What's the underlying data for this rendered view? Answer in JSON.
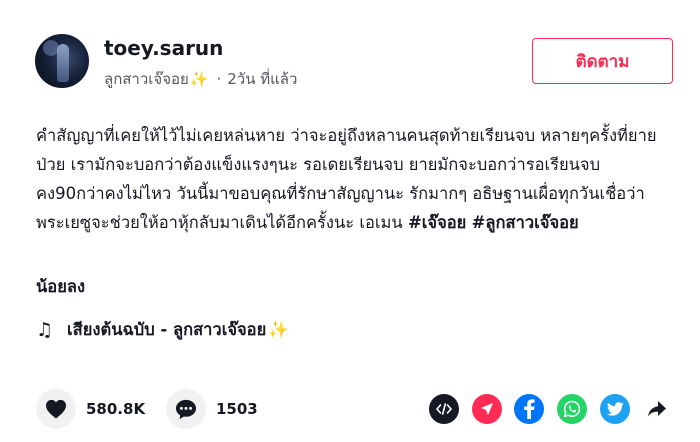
{
  "author": {
    "username": "toey.sarun",
    "display_name": "ลูกสาวเจ๊จอย",
    "spark": "✨",
    "separator": "·",
    "posted_ago": "2วัน ที่แล้ว"
  },
  "follow_label": "ติดตาม",
  "caption": {
    "text": "คำสัญญาที่เคยให้ไว้ไม่เคยหล่นหาย ว่าจะอยู่ถึงหลานคนสุดท้ายเรียนจบ หลายๆครั้งที่ยายป่วย เรามักจะบอกว่าต้องแข็งแรงๆนะ รอเดยเรียนจบ ยายมักจะบอกว่ารอเรียนจบคง90กว่าคงไม่ไหว วันนี้มาขอบคุณที่รักษาสัญญานะ รักมากๆ อธิษฐานเผื่อทุกวันเชื่อว่าพระเยซูจะช่วยให้อาหุ้กลับมาเดินได้อีกครั้งนะ เอเมน",
    "hashtags": [
      "#เจ๊จอย",
      "#ลูกสาวเจ๊จอย"
    ],
    "less_label": "น้อยลง"
  },
  "music": {
    "note_glyph": "♫",
    "title": "เสียงต้นฉบับ - ลูกสาวเจ๊จอย",
    "spark": "✨"
  },
  "stats": {
    "likes": "580.8K",
    "comments": "1503"
  },
  "share_icons": [
    {
      "name": "embed-icon",
      "color": "#161823"
    },
    {
      "name": "send-to-friends-icon",
      "color": "#fe2c55"
    },
    {
      "name": "facebook-icon",
      "color": "#0075fa"
    },
    {
      "name": "whatsapp-icon",
      "color": "#25d366"
    },
    {
      "name": "twitter-icon",
      "color": "#1da1f2"
    },
    {
      "name": "share-arrow-icon",
      "color": "#161823"
    }
  ]
}
